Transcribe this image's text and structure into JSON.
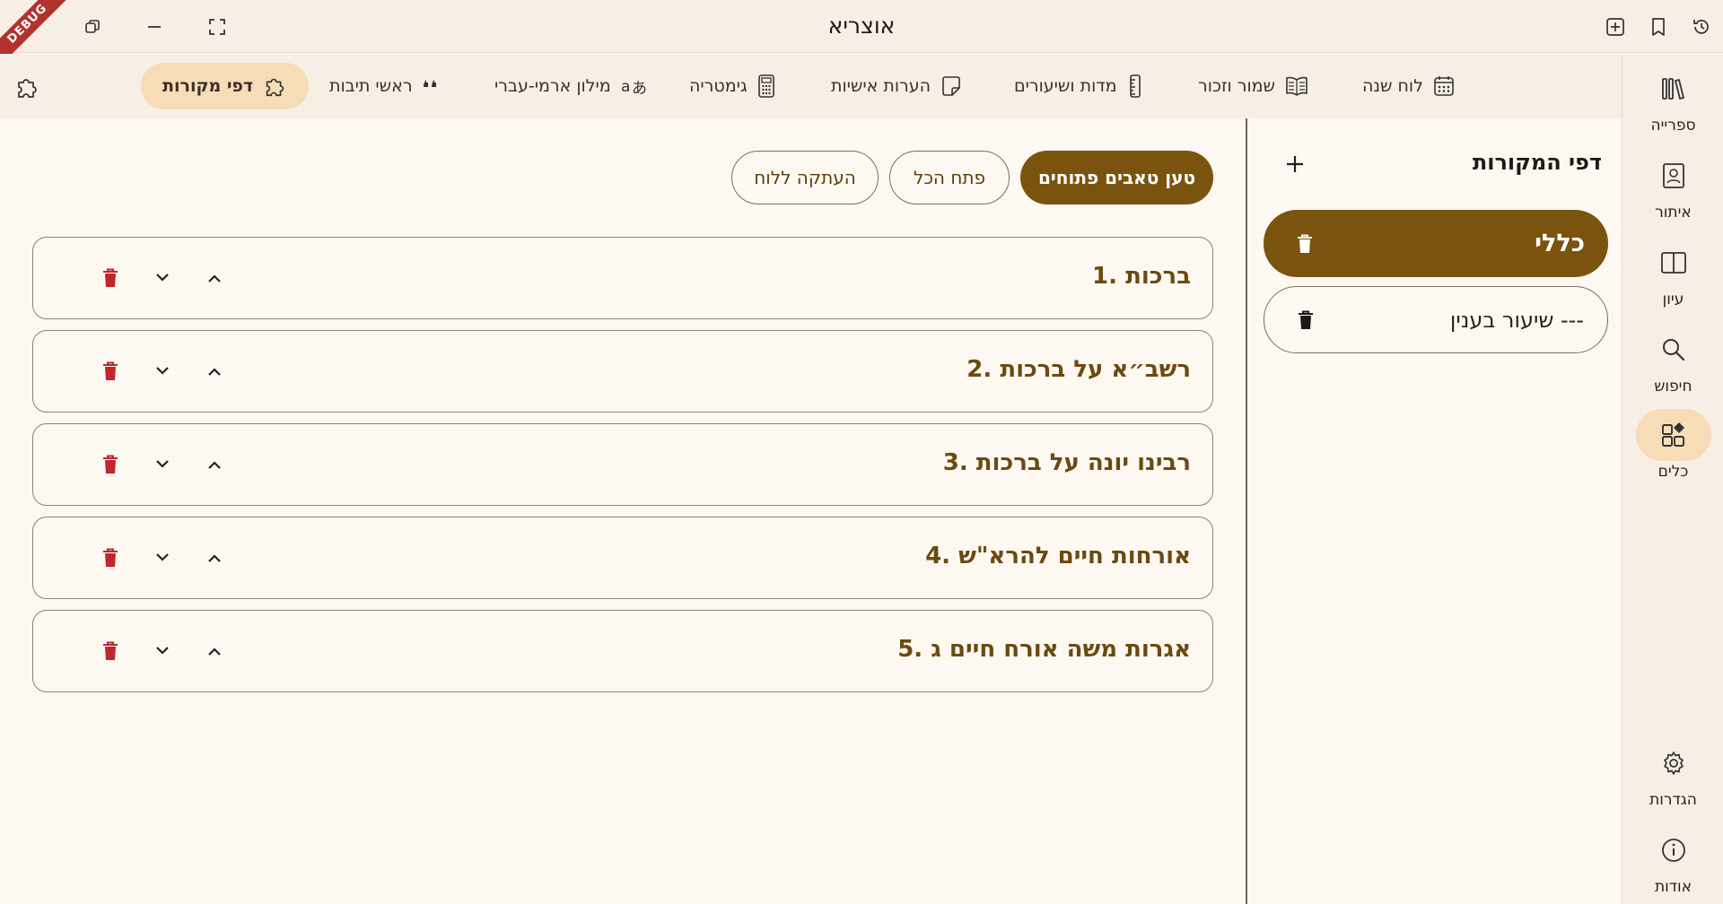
{
  "window": {
    "title": "אוצריא",
    "debug_label": "DEBUG"
  },
  "tools": [
    {
      "id": "calendar",
      "label": "לוח שנה",
      "icon": "calendar-icon"
    },
    {
      "id": "shamor",
      "label": "שמור וזכור",
      "icon": "open-book-icon"
    },
    {
      "id": "measures",
      "label": "מדות ושיעורים",
      "icon": "ruler-icon"
    },
    {
      "id": "notes",
      "label": "הערות אישיות",
      "icon": "note-icon"
    },
    {
      "id": "gematria",
      "label": "גימטריה",
      "icon": "calculator-icon"
    },
    {
      "id": "dictionary",
      "label": "מילון ארמי-עברי",
      "icon": "translate-icon"
    },
    {
      "id": "acronyms",
      "label": "ראשי תיבות",
      "icon": "quote-icon"
    },
    {
      "id": "sources",
      "label": "דפי מקורות",
      "icon": "puzzle-icon",
      "active": true
    }
  ],
  "rail": [
    {
      "label": "ספרייה",
      "icon": "library-icon"
    },
    {
      "label": "איתור",
      "icon": "find-book-icon"
    },
    {
      "label": "עיון",
      "icon": "reading-icon"
    },
    {
      "label": "חיפוש",
      "icon": "search-icon"
    },
    {
      "label": "כלים",
      "icon": "tools-icon",
      "active": true
    },
    {
      "label": "הגדרות",
      "icon": "gear-icon"
    },
    {
      "label": "אודות",
      "icon": "info-icon"
    }
  ],
  "sources_panel": {
    "title": "דפי המקורות",
    "items": [
      {
        "label": "כללי",
        "selected": true
      },
      {
        "label": "שיעור בענין ---",
        "selected": false
      }
    ]
  },
  "actions": {
    "load_tabs": "טען טאבים פתוחים",
    "open_all": "פתח הכל",
    "copy_to_board": "העתקה ללוח"
  },
  "sources_list": [
    {
      "index": "1.",
      "title": "ברכות",
      "text": "1. ברכות"
    },
    {
      "index": "2.",
      "title": "רשב״א על ברכות",
      "text": "2. רשב״א על ברכות"
    },
    {
      "index": "3.",
      "title": "רבינו יונה על ברכות",
      "text": "3. רבינו יונה על ברכות"
    },
    {
      "index": "4.",
      "title": "אורחות חיים להרא\"ש",
      "text": "4. אורחות חיים להרא\"ש"
    },
    {
      "index": "5.",
      "title": "אגרות משה אורח חיים ג",
      "text": "5. אגרות משה אורח חיים ג"
    }
  ],
  "colors": {
    "accent": "#7a540e",
    "accent_light": "#f7dcb8",
    "background": "#fdf8f1",
    "bar": "#f7efe5",
    "delete": "#c0262d",
    "title_text": "#6b4a10"
  }
}
